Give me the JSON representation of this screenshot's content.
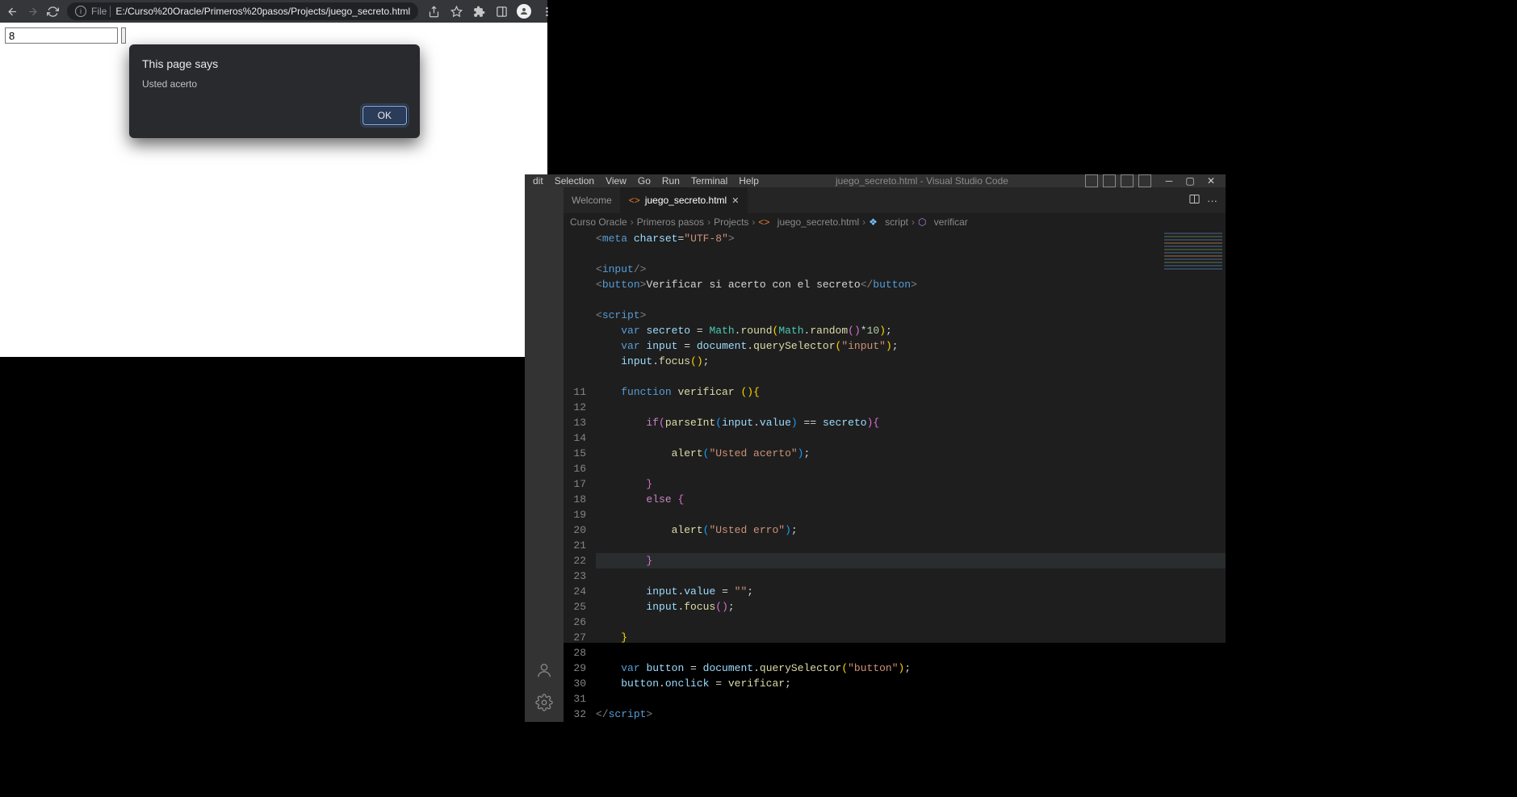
{
  "browser": {
    "url_prefix": "File ",
    "url": "E:/Curso%20Oracle/Primeros%20pasos/Projects/juego_secreto.html",
    "input_value": "8"
  },
  "alert": {
    "title": "This page says",
    "message": "Usted acerto",
    "ok": "OK"
  },
  "vscode": {
    "menu": {
      "edit": "dit",
      "selection": "Selection",
      "view": "View",
      "go": "Go",
      "run": "Run",
      "terminal": "Terminal",
      "help": "Help"
    },
    "title": "juego_secreto.html - Visual Studio Code",
    "tabs": {
      "welcome": "Welcome",
      "file": "juego_secreto.html"
    },
    "breadcrumb": {
      "p0": "Curso Oracle",
      "p1": "Primeros pasos",
      "p2": "Projects",
      "p3": "juego_secreto.html",
      "p4": "script",
      "p5": "verificar"
    },
    "lines": {
      "l11": "11",
      "l12": "12",
      "l13": "13",
      "l14": "14",
      "l15": "15",
      "l16": "16",
      "l17": "17",
      "l18": "18",
      "l19": "19",
      "l20": "20",
      "l21": "21",
      "l22": "22",
      "l23": "23",
      "l24": "24",
      "l25": "25",
      "l26": "26",
      "l27": "27",
      "l28": "28",
      "l29": "29",
      "l30": "30",
      "l31": "31",
      "l32": "32"
    },
    "code": {
      "meta_open": "<",
      "meta": "meta",
      "charset_attr": "charset",
      "eq": "=",
      "charset_val": "\"UTF-8\"",
      "close": ">",
      "input_tag": "input",
      "self_close": "/>",
      "button_tag": "button",
      "button_text": "Verificar si acerto con el secreto",
      "button_close": "</",
      "script_tag": "script",
      "var": "var",
      "secreto": "secreto",
      "assign": " = ",
      "Math": "Math",
      "dot": ".",
      "round": "round",
      "random": "random",
      "times10": "*",
      "ten": "10",
      "semi": ";",
      "input": "input",
      "document": "document",
      "querySelector": "querySelector",
      "input_sel": "\"input\"",
      "focus": "focus",
      "empty_args": "()",
      "function": "function",
      "verificar": "verificar",
      "if": "if",
      "parseInt": "parseInt",
      "value": "value",
      "eqeq": " == ",
      "alert": "alert",
      "acerto": "\"Usted acerto\"",
      "erro": "\"Usted erro\"",
      "else": "else",
      "empty_str": "\"\"",
      "button": "button",
      "button_sel": "\"button\"",
      "onclick": "onclick"
    }
  }
}
